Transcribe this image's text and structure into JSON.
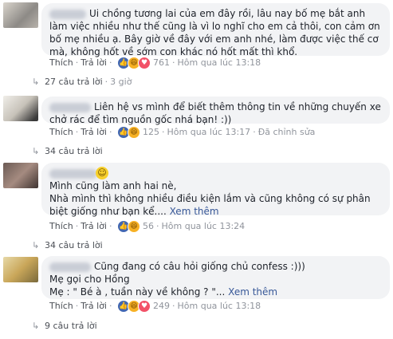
{
  "comments": [
    {
      "text": "Ui chồng tương lai của em đây rồi, lâu nay bố mẹ bắt anh làm việc nhiều như thế cũng là vì lo nghĩ cho em cả thôi, con cảm ơn bố mẹ nhiều ạ. Bây giờ về đây với em anh nhé, làm được việc thế cơ mà, không hốt về sớm con khác nó hốt mất thì khổ.",
      "actions": {
        "like": "Thích",
        "reply": "Trả lời",
        "reaction_count": "761",
        "time": "Hôm qua lúc 13:18",
        "extra": ""
      },
      "replies": {
        "arrow": "↳",
        "label": "27 câu trả lời",
        "time": "3 giờ"
      }
    },
    {
      "text": "Liên hệ vs mình để biết thêm thông tin về những chuyến xe chở rác để tìm nguồn gốc nhá bạn! :))",
      "actions": {
        "like": "Thích",
        "reply": "Trả lời",
        "reaction_count": "125",
        "time": "Hôm qua lúc 13:17",
        "extra": "Đã chỉnh sửa"
      },
      "replies": {
        "arrow": "↳",
        "label": "34 câu trả lời"
      }
    },
    {
      "text_line1": "Mình cũng làm anh hai nè,",
      "text_line2": "Nhà mình thì không nhiều điều kiện lắm và cũng không có sự phân biệt giống như bạn kể....",
      "see_more": "Xem thêm",
      "actions": {
        "like": "Thích",
        "reply": "Trả lời",
        "reaction_count": "56",
        "time": "Hôm qua lúc 13:24"
      },
      "replies": {
        "arrow": "↳",
        "label": "34 câu trả lời"
      }
    },
    {
      "text_line1": "Cũng đang có câu hỏi giống chủ confess :)))",
      "text_line2": "Mẹ gọi cho Hồng",
      "text_line3": "Mẹ : \" Bé à , tuần này về không ? \"...",
      "see_more": "Xem thêm",
      "actions": {
        "like": "Thích",
        "reply": "Trả lời",
        "reaction_count": "249",
        "time": "Hôm qua lúc 13:18"
      },
      "replies": {
        "arrow": "↳",
        "label": "9 câu trả lời"
      }
    }
  ],
  "colors": {
    "bubble": "#f2f3f5",
    "link": "#385898",
    "meta": "#90949c",
    "like": "#4267b2",
    "haha": "#f7b125",
    "heart": "#f25268"
  }
}
